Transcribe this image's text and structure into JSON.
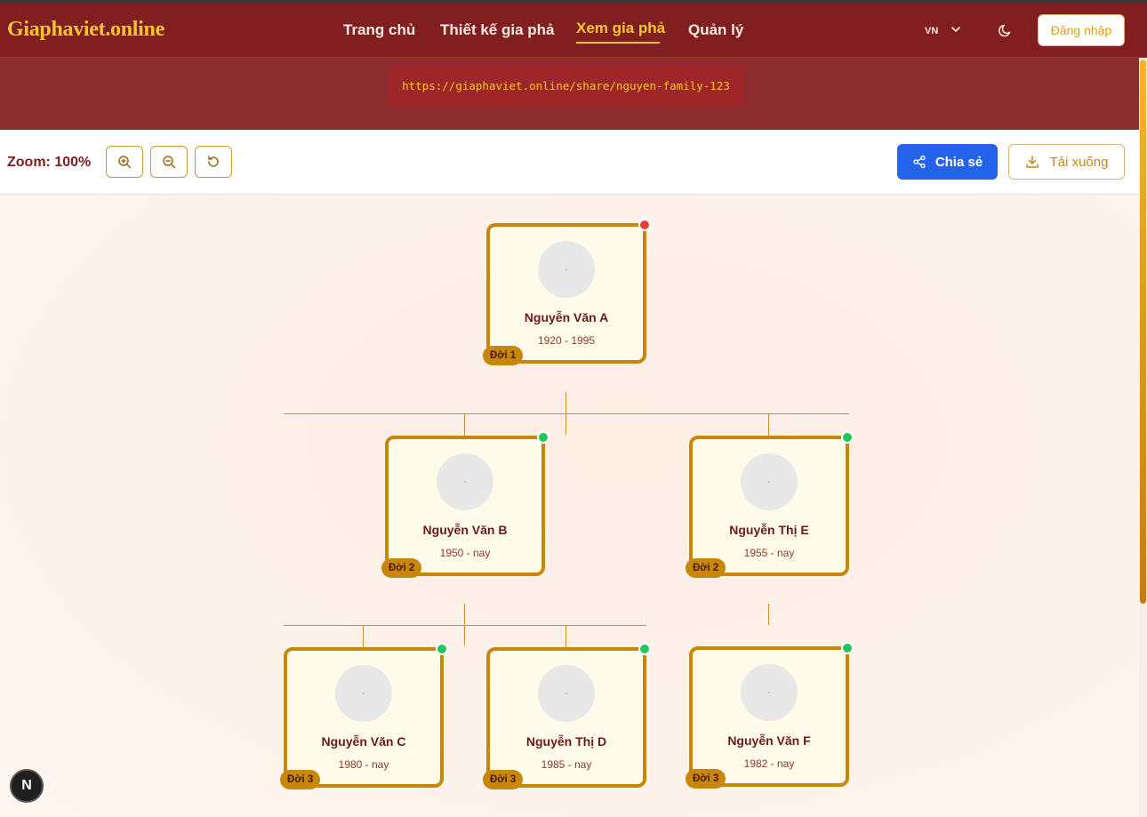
{
  "nav": {
    "brand": "Giaphaviet.online",
    "links": [
      "Trang chủ",
      "Thiết kế gia phả",
      "Xem gia phả",
      "Quản lý"
    ],
    "lang": "VN",
    "login": "Đăng nhập"
  },
  "share_url": "https://giaphaviet.online/share/nguyen-family-123",
  "toolbar": {
    "zoom_label": "Zoom: 100%",
    "share_label": "Chia sẻ",
    "download_label": "Tải xuống"
  },
  "people": [
    {
      "name": "Nguyễn Văn A",
      "years": "1920 - 1995",
      "generation": "Đời 1",
      "status": "dead"
    },
    {
      "name": "Nguyễn Văn B",
      "years": "1950 - nay",
      "generation": "Đời 2",
      "status": "alive"
    },
    {
      "name": "Nguyễn Thị E",
      "years": "1955 - nay",
      "generation": "Đời 2",
      "status": "alive"
    },
    {
      "name": "Nguyễn Văn C",
      "years": "1980 - nay",
      "generation": "Đời 3",
      "status": "alive"
    },
    {
      "name": "Nguyễn Thị D",
      "years": "1985 - nay",
      "generation": "Đời 3",
      "status": "alive"
    },
    {
      "name": "Nguyễn Văn F",
      "years": "1982 - nay",
      "generation": "Đời 3",
      "status": "alive"
    }
  ],
  "colors": {
    "nav_bg": "#811f20",
    "brand": "#f7c62f",
    "card_border": "#c9870a",
    "share_button": "#2563eb",
    "alive": "#22c55e",
    "dead": "#e53e3e"
  }
}
